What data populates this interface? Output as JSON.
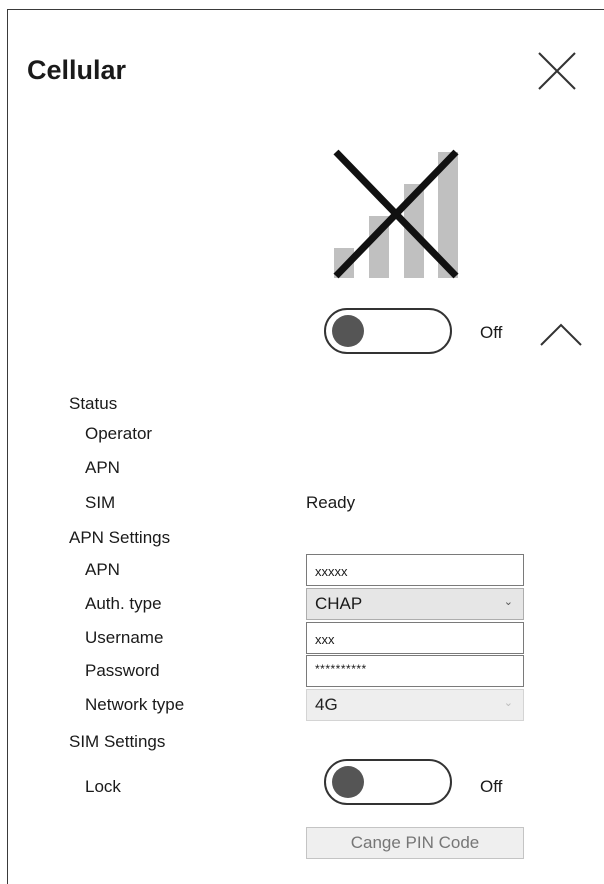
{
  "title": "Cellular",
  "icons": {
    "close": "close-icon",
    "signal": "cellular-signal-disabled-icon",
    "collapse": "chevron-up-icon"
  },
  "colors": {
    "toggle_knob": "#555555",
    "signal_bars": "#c0c0c0",
    "signal_cross": "#111111"
  },
  "cellular_toggle": {
    "state_label": "Off",
    "on": false
  },
  "status": {
    "heading": "Status",
    "operator_label": "Operator",
    "operator_value": "",
    "apn_label": "APN",
    "apn_value": "",
    "sim_label": "SIM",
    "sim_value": "Ready"
  },
  "apn_settings": {
    "heading": "APN Settings",
    "apn_label": "APN",
    "apn_value": "xxxxx",
    "auth_label": "Auth. type",
    "auth_value": "CHAP",
    "username_label": "Username",
    "username_value": "xxx",
    "password_label": "Password",
    "password_value": "**********",
    "network_label": "Network type",
    "network_value": "4G"
  },
  "sim_settings": {
    "heading": "SIM Settings",
    "lock_label": "Lock",
    "lock_state_label": "Off",
    "lock_on": false,
    "change_pin_label": "Cange PIN Code"
  }
}
